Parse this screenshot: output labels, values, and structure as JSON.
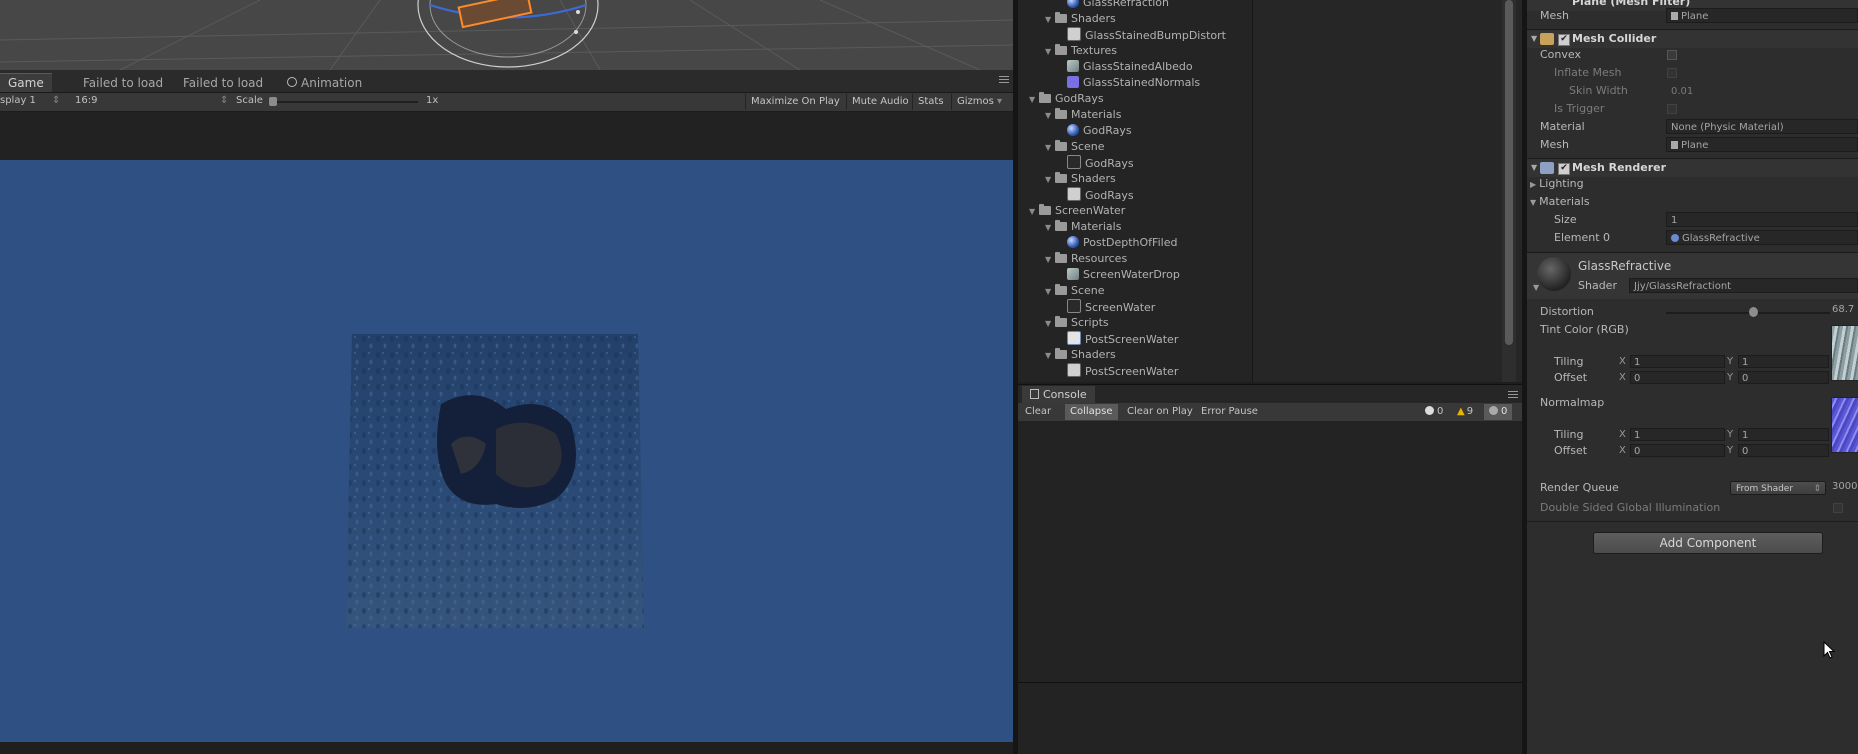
{
  "game": {
    "tabs": [
      {
        "label": "Game",
        "active": true
      },
      {
        "label": "Failed to load"
      },
      {
        "label": "Failed to load"
      },
      {
        "label": "Animation"
      }
    ],
    "toolbar": {
      "display": "splay 1",
      "aspect": "16:9",
      "scale_label": "Scale",
      "scale_value": "1x",
      "maximize": "Maximize On Play",
      "mute": "Mute Audio",
      "stats": "Stats",
      "gizmos": "Gizmos"
    },
    "background_color": "#2e5082"
  },
  "project": {
    "items": [
      {
        "label": "GlassRefraction",
        "level": 2,
        "type": "material"
      },
      {
        "label": "Shaders",
        "level": 1,
        "type": "folder"
      },
      {
        "label": "GlassStainedBumpDistort",
        "level": 2,
        "type": "shader"
      },
      {
        "label": "Textures",
        "level": 1,
        "type": "folder"
      },
      {
        "label": "GlassStainedAlbedo",
        "level": 2,
        "type": "texture-a"
      },
      {
        "label": "GlassStainedNormals",
        "level": 2,
        "type": "texture-b"
      },
      {
        "label": "GodRays",
        "level": 0,
        "type": "folder"
      },
      {
        "label": "Materials",
        "level": 1,
        "type": "folder"
      },
      {
        "label": "GodRays",
        "level": 2,
        "type": "material"
      },
      {
        "label": "Scene",
        "level": 1,
        "type": "folder"
      },
      {
        "label": "GodRays",
        "level": 2,
        "type": "scene"
      },
      {
        "label": "Shaders",
        "level": 1,
        "type": "folder"
      },
      {
        "label": "GodRays",
        "level": 2,
        "type": "shader"
      },
      {
        "label": "ScreenWater",
        "level": 0,
        "type": "folder"
      },
      {
        "label": "Materials",
        "level": 1,
        "type": "folder"
      },
      {
        "label": "PostDepthOfFiled",
        "level": 2,
        "type": "material"
      },
      {
        "label": "Resources",
        "level": 1,
        "type": "folder"
      },
      {
        "label": "ScreenWaterDrop",
        "level": 2,
        "type": "texture-a"
      },
      {
        "label": "Scene",
        "level": 1,
        "type": "folder"
      },
      {
        "label": "ScreenWater",
        "level": 2,
        "type": "scene"
      },
      {
        "label": "Scripts",
        "level": 1,
        "type": "folder"
      },
      {
        "label": "PostScreenWater",
        "level": 2,
        "type": "script"
      },
      {
        "label": "Shaders",
        "level": 1,
        "type": "folder"
      },
      {
        "label": "PostScreenWater",
        "level": 2,
        "type": "shader"
      }
    ]
  },
  "console": {
    "tab": "Console",
    "buttons": {
      "clear": "Clear",
      "collapse": "Collapse",
      "clear_on_play": "Clear on Play",
      "error_pause": "Error Pause"
    },
    "counts": {
      "info": "0",
      "warnings": "9",
      "errors": "0"
    }
  },
  "inspector": {
    "mesh_filter": {
      "title": "Plane (Mesh Filter)",
      "mesh_label": "Mesh",
      "mesh_value": "Plane"
    },
    "mesh_collider": {
      "title": "Mesh Collider",
      "convex": "Convex",
      "inflate_mesh": "Inflate Mesh",
      "skin_width": "Skin Width",
      "skin_width_value": "0.01",
      "is_trigger": "Is Trigger",
      "material_label": "Material",
      "material_value": "None (Physic Material)",
      "mesh_label": "Mesh",
      "mesh_value": "Plane"
    },
    "mesh_renderer": {
      "title": "Mesh Renderer",
      "lighting": "Lighting",
      "materials": "Materials",
      "size_label": "Size",
      "size_value": "1",
      "element0_label": "Element 0",
      "element0_value": "GlassRefractive"
    },
    "material": {
      "name": "GlassRefractive",
      "shader_label": "Shader",
      "shader_value": "Jjy/GlassRefractiont",
      "distortion_label": "Distortion",
      "distortion_value": "68.7",
      "distortion_fraction": 0.53,
      "tint_label": "Tint Color (RGB)",
      "normalmap_label": "Normalmap",
      "tiling_label": "Tiling",
      "offset_label": "Offset",
      "tint_tiling": {
        "x": "1",
        "y": "1"
      },
      "tint_offset": {
        "x": "0",
        "y": "0"
      },
      "normal_tiling": {
        "x": "1",
        "y": "1"
      },
      "normal_offset": {
        "x": "0",
        "y": "0"
      },
      "render_queue_label": "Render Queue",
      "render_queue_mode": "From Shader",
      "render_queue_value": "3000",
      "double_sided": "Double Sided Global Illumination"
    },
    "add_component": "Add Component"
  }
}
